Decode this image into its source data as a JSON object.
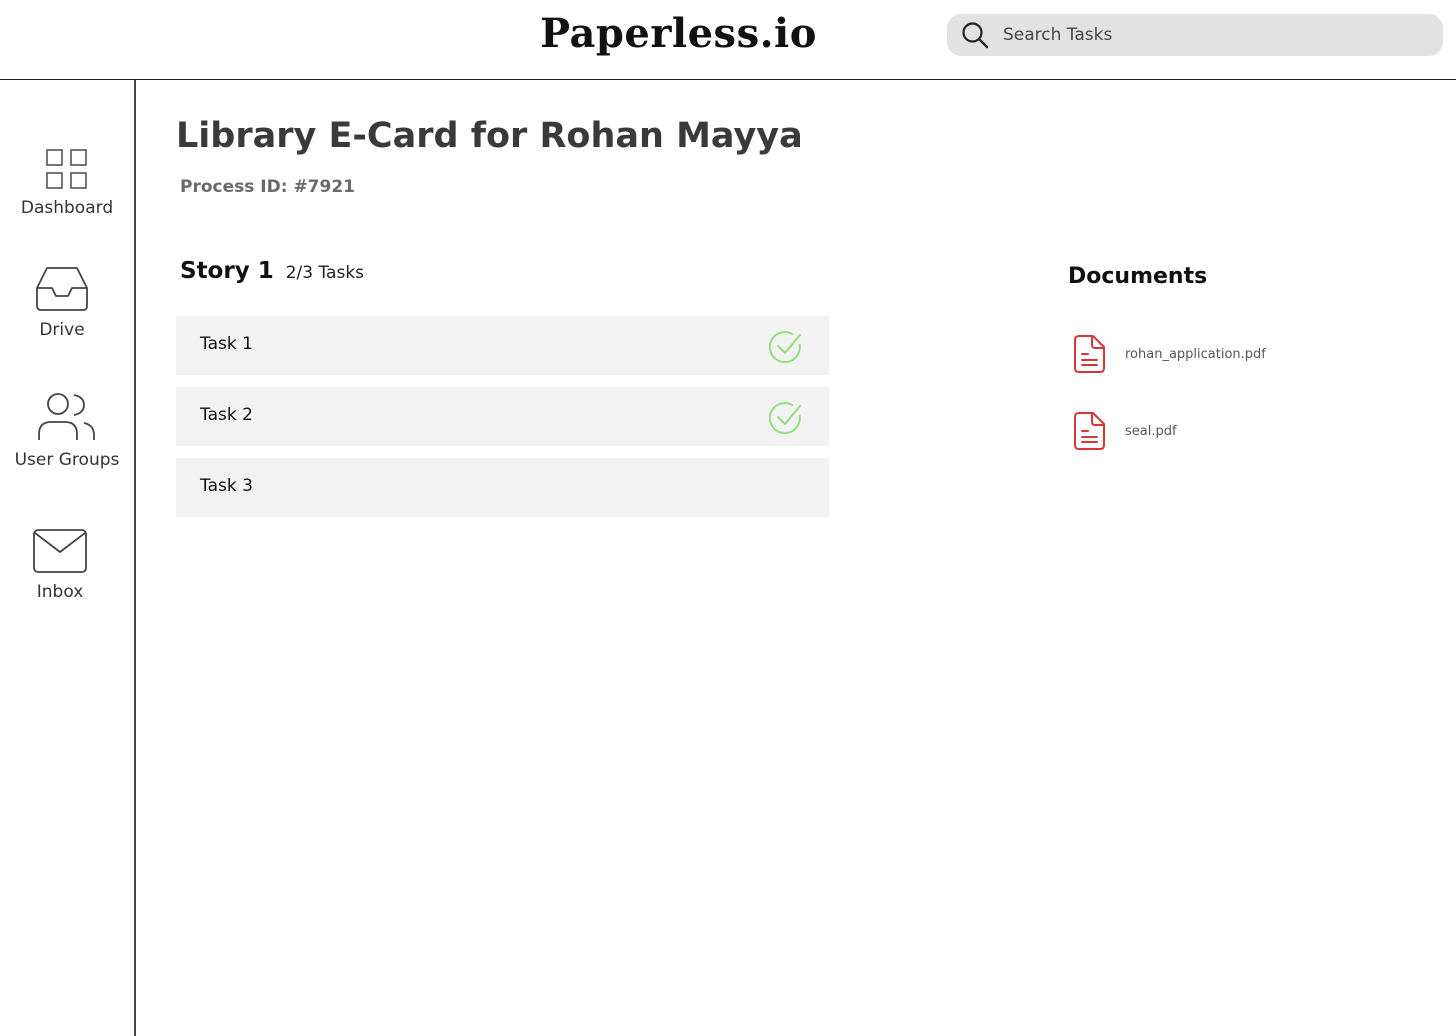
{
  "header": {
    "brand": "Paperless.io",
    "search": {
      "placeholder": "Search Tasks",
      "icon": "search-icon"
    }
  },
  "sidebar": {
    "items": [
      {
        "label": "Dashboard",
        "icon": "dashboard-grid-icon"
      },
      {
        "label": "Drive",
        "icon": "inbox-tray-icon"
      },
      {
        "label": "User Groups",
        "icon": "users-icon"
      },
      {
        "label": "Inbox",
        "icon": "mail-icon"
      }
    ]
  },
  "main": {
    "title": "Library E-Card for Rohan Mayya",
    "process_id": "Process ID: #7921",
    "story": {
      "title": "Story 1",
      "progress": "2/3 Tasks",
      "tasks": [
        {
          "label": "Task 1",
          "completed": true
        },
        {
          "label": "Task 2",
          "completed": true
        },
        {
          "label": "Task 3",
          "completed": false
        }
      ]
    }
  },
  "documents": {
    "title": "Documents",
    "files": [
      {
        "name": "rohan_application.pdf",
        "icon": "document-icon"
      },
      {
        "name": "seal.pdf",
        "icon": "document-icon"
      }
    ]
  },
  "colors": {
    "check": "#8fe07a",
    "doc_icon": "#d63838",
    "search_bg": "#e2e2e2",
    "task_bg": "#f2f2f2"
  }
}
